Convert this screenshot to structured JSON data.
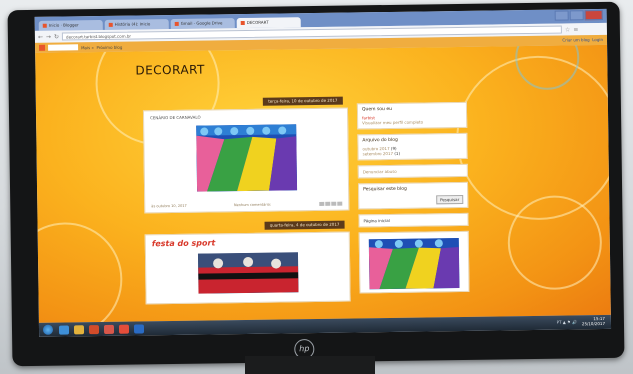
{
  "browser": {
    "tabs": [
      {
        "label": "Inicio · Blogger"
      },
      {
        "label": "História (4): Inicio"
      },
      {
        "label": "Gmail - Google Drive"
      },
      {
        "label": "DECORART",
        "active": true
      }
    ],
    "url": "decorart.tarbist.blogspot.com.br"
  },
  "blogger_bar": {
    "search_label": "Mais »",
    "next_blog": "Próximo blog",
    "create_blog": "Criar um blog",
    "login": "Login"
  },
  "blog": {
    "title": "DECORART",
    "posts": [
      {
        "date": "terça-feira, 10 de outubro de 2017",
        "title": "CENÁRIO DE CARNAVALO",
        "footer_left": "às outubro 10, 2017",
        "footer_mid": "Nenhum comentário:"
      },
      {
        "date": "quarta-feira, 4 de outubro de 2017",
        "title": "festa do sport"
      }
    ]
  },
  "sidebar": {
    "about_title": "Quem sou eu",
    "author": "farbist",
    "profile_link": "Visualizar meu perfil completo",
    "archive_title": "Arquivo do blog",
    "archive_items": [
      {
        "label": "outubro 2017",
        "count": "(9)"
      },
      {
        "label": "setembro 2017",
        "count": "(1)"
      }
    ],
    "report_abuse": "Denunciar abuso",
    "search_title": "Pesquisar este blog",
    "search_button": "Pesquisar",
    "home_page": "Página inicial"
  },
  "taskbar": {
    "time": "15:17",
    "date": "25/10/2017",
    "tray_label": "PT"
  },
  "monitor_brand": "hp",
  "colors": {
    "page_orange": "#f39314",
    "page_yellow": "#ffd23a",
    "date_bar": "#5b3a1b",
    "post_title_red": "#d8382a",
    "taskbar": "#1f2a36"
  }
}
